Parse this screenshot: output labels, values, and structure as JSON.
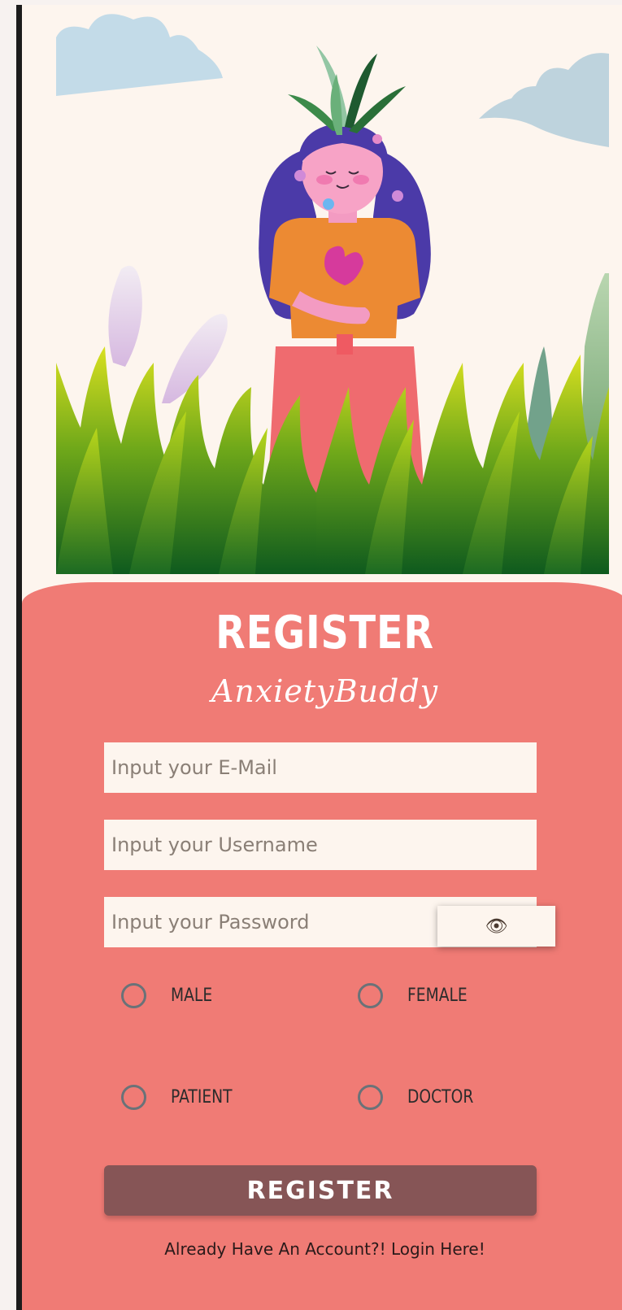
{
  "form": {
    "title": "REGISTER",
    "app_name": "AnxietyBuddy",
    "email_placeholder": "Input your E-Mail",
    "username_placeholder": "Input your Username",
    "password_placeholder": "Input your Password",
    "eye_icon": "👁",
    "gender_options": [
      "MALE",
      "FEMALE"
    ],
    "role_options": [
      "PATIENT",
      "DOCTOR"
    ],
    "submit_label": "REGISTER",
    "login_link": "Already Have An Account?! Login Here!"
  },
  "colors": {
    "background": "#fdf5ee",
    "panel": "#f07b75",
    "button": "#865556"
  }
}
